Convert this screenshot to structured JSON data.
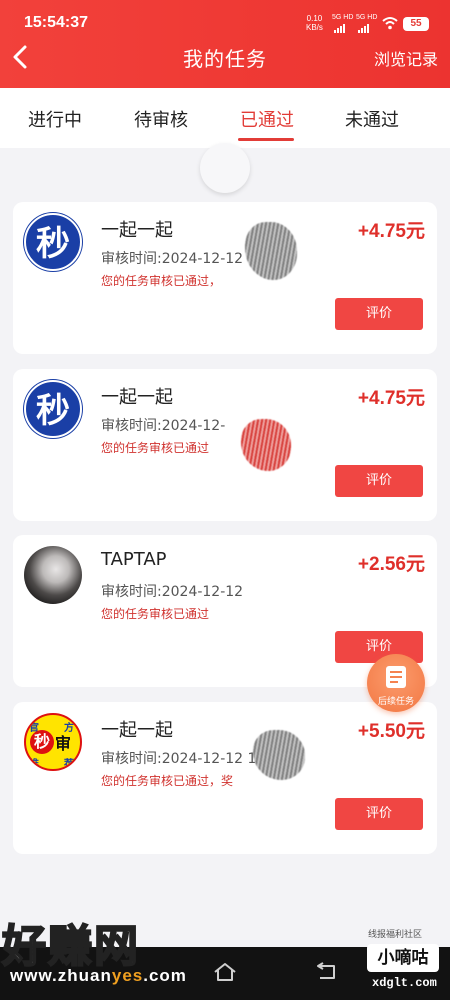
{
  "status_bar": {
    "time": "15:54:37",
    "net_speed": "0.10",
    "net_unit": "KB/s",
    "sig1": "5G HD",
    "sig2": "5G HD",
    "battery": "55"
  },
  "header": {
    "title": "我的任务",
    "right_link": "浏览记录"
  },
  "tabs": [
    {
      "label": "进行中"
    },
    {
      "label": "待审核"
    },
    {
      "label": "已通过"
    },
    {
      "label": "未通过"
    }
  ],
  "active_tab": "已通过",
  "tasks": [
    {
      "name": "一起一起",
      "audit_time": "审核时间:2024-12-12 1",
      "notice": "您的任务审核已通过，",
      "reward": "+4.75元",
      "button": "评价",
      "avatar_char": "秒"
    },
    {
      "name": "一起一起",
      "audit_time": "审核时间:2024-12-",
      "notice": "您的任务审核已通过",
      "reward": "+4.75元",
      "button": "评价",
      "avatar_char": "秒"
    },
    {
      "name": "TAPTAP",
      "audit_time": "审核时间:2024-12-12",
      "notice": "您的任务审核已通过",
      "reward": "+2.56元",
      "button": "评价"
    },
    {
      "name": "一起一起",
      "audit_time": "审核时间:2024-12-12 1",
      "notice": "您的任务审核已通过，奖",
      "reward": "+5.50元",
      "button": "评价",
      "avatar_chars": {
        "center": "秒",
        "right": "审",
        "tl": "官",
        "tr": "方",
        "bl": "推",
        "br": "荐"
      }
    }
  ],
  "floating_button": {
    "label": "后续任务",
    "icon": "task-list-icon"
  },
  "watermark": {
    "big": "好赚网",
    "url_pre": "www.zhuan",
    "url_hl": "yes",
    "url_post": ".com",
    "small": "线报福利社区",
    "logo": "小嘀咕",
    "logo_url": "xdglt.com"
  },
  "colors": {
    "header": "#ef3a35",
    "accent": "#e23c37",
    "button": "#f04643",
    "reward": "#df2f2a",
    "float": "#f5824f"
  }
}
